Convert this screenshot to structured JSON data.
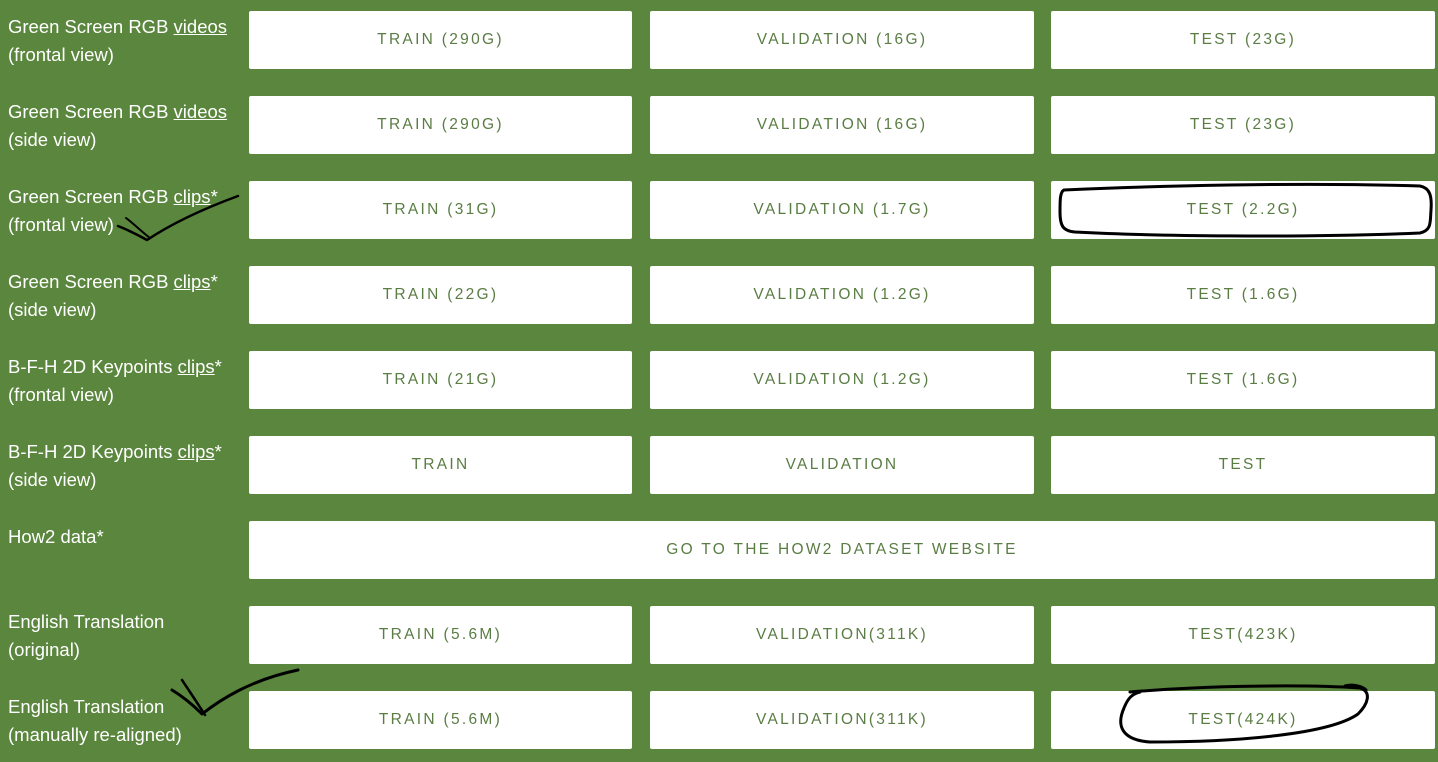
{
  "rows": [
    {
      "label_pre": "Green Screen RGB ",
      "label_link": "videos",
      "label_post": "",
      "label_line2": "(frontal view)",
      "buttons": [
        "TRAIN (290G)",
        "VALIDATION (16G)",
        "TEST (23G)"
      ]
    },
    {
      "label_pre": "Green Screen RGB ",
      "label_link": "videos",
      "label_post": "",
      "label_line2": "(side view)",
      "buttons": [
        "TRAIN (290G)",
        "VALIDATION (16G)",
        "TEST (23G)"
      ]
    },
    {
      "label_pre": "Green Screen RGB ",
      "label_link": "clips",
      "label_post": "*",
      "label_line2": "(frontal view)",
      "buttons": [
        "TRAIN (31G)",
        "VALIDATION (1.7G)",
        "TEST (2.2G)"
      ]
    },
    {
      "label_pre": "Green Screen RGB ",
      "label_link": "clips",
      "label_post": "*",
      "label_line2": "(side view)",
      "buttons": [
        "TRAIN (22G)",
        "VALIDATION (1.2G)",
        "TEST (1.6G)"
      ]
    },
    {
      "label_pre": "B-F-H 2D Keypoints ",
      "label_link": "clips",
      "label_post": "*",
      "label_line2": "(frontal view)",
      "buttons": [
        "TRAIN (21G)",
        "VALIDATION (1.2G)",
        "TEST (1.6G)"
      ]
    },
    {
      "label_pre": "B-F-H 2D Keypoints ",
      "label_link": "clips",
      "label_post": "*",
      "label_line2": "(side view)",
      "buttons": [
        "TRAIN",
        "VALIDATION",
        "TEST"
      ]
    },
    {
      "label_pre": "How2 data*",
      "wide_button": "GO TO THE HOW2 DATASET WEBSITE"
    },
    {
      "label_pre": "English Translation",
      "label_line2": "(original)",
      "buttons": [
        "TRAIN (5.6M)",
        "VALIDATION(311K)",
        "TEST(423K)"
      ]
    },
    {
      "label_pre": "English Translation",
      "label_line2": "(manually re-aligned)",
      "buttons": [
        "TRAIN (5.6M)",
        "VALIDATION(311K)",
        "TEST(424K)"
      ]
    }
  ],
  "colors": {
    "background": "#5a863d",
    "button_bg": "#ffffff",
    "button_text": "#5a7d44",
    "annotation_ink": "#000000"
  }
}
